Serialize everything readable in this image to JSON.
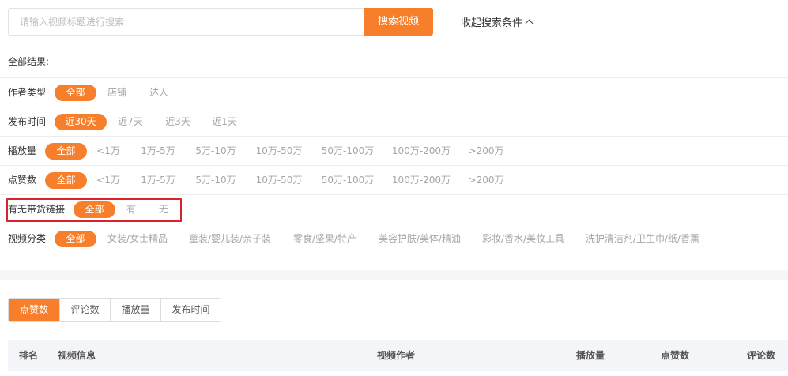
{
  "search": {
    "placeholder": "请输入视频标题进行搜索",
    "button_label": "搜索视频",
    "collapse_label": "收起搜索条件"
  },
  "summary": {
    "all_results_label": "全部结果:"
  },
  "filters": {
    "author_type": {
      "label": "作者类型",
      "options": [
        "全部",
        "店铺",
        "达人"
      ],
      "selected": "全部"
    },
    "publish_time": {
      "label": "发布时间",
      "options": [
        "近30天",
        "近7天",
        "近3天",
        "近1天"
      ],
      "selected": "近30天"
    },
    "play_count": {
      "label": "播放量",
      "options": [
        "全部",
        "<1万",
        "1万-5万",
        "5万-10万",
        "10万-50万",
        "50万-100万",
        "100万-200万",
        ">200万"
      ],
      "selected": "全部"
    },
    "like_count": {
      "label": "点赞数",
      "options": [
        "全部",
        "<1万",
        "1万-5万",
        "5万-10万",
        "10万-50万",
        "50万-100万",
        "100万-200万",
        ">200万"
      ],
      "selected": "全部"
    },
    "goods_link": {
      "label": "有无带货链接",
      "options": [
        "全部",
        "有",
        "无"
      ],
      "selected": "全部"
    },
    "video_category": {
      "label": "视频分类",
      "options": [
        "全部",
        "女装/女士精品",
        "童装/婴儿装/亲子装",
        "零食/坚果/特产",
        "美容护肤/美体/精油",
        "彩妆/香水/美妆工具",
        "洗护清洁剂/卫生巾/纸/香薰"
      ],
      "selected": "全部"
    }
  },
  "sort_tabs": {
    "items": [
      "点赞数",
      "评论数",
      "播放量",
      "发布时间"
    ],
    "active": "点赞数"
  },
  "table": {
    "columns": [
      "排名",
      "视频信息",
      "视频作者",
      "播放量",
      "点赞数",
      "评论数"
    ]
  },
  "colors": {
    "accent": "#f77e2a",
    "highlight_border": "#d8232a",
    "muted_text": "#a6a6a6"
  },
  "icons": {
    "collapse": "chevron-up-icon"
  }
}
